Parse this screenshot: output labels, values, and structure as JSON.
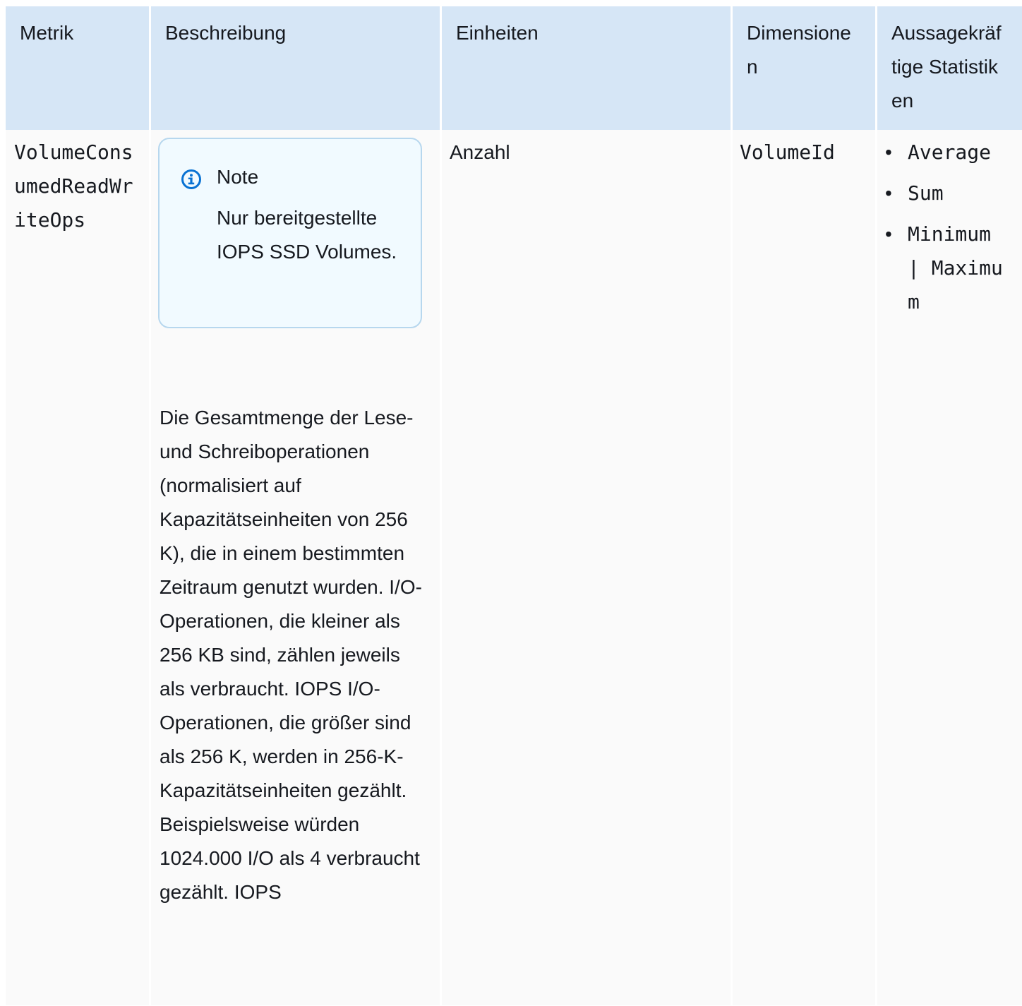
{
  "table": {
    "headers": {
      "metric": "Metrik",
      "description": "Beschreibung",
      "units": "Einheiten",
      "dimensions": "Dimensionen",
      "statistics": "Aussagekräftige Statistiken"
    },
    "row": {
      "metric": "VolumeConsumedReadWriteOps",
      "note": {
        "title": "Note",
        "text": "Nur bereitgestellte IOPS SSD Volumes."
      },
      "description": "Die Gesamtmenge der Lese- und Schreiboperationen (normalisiert auf Kapazitätseinheiten von 256 K), die in einem bestimmten Zeitraum genutzt wurden. I/O-Operationen, die kleiner als 256 KB sind, zählen jeweils als verbraucht. IOPS I/O-Operationen, die größer sind als 256 K, werden in 256-K-Kapazitätseinheiten gezählt. Beispielsweise würden 1024.000 I/O als 4 verbraucht gezählt. IOPS",
      "units": "Anzahl",
      "dimension": "VolumeId",
      "statistics": [
        "Average",
        "Sum",
        "Minimum | Maximum"
      ]
    }
  },
  "icons": {
    "note": "info-icon"
  },
  "colors": {
    "header_bg": "#d6e6f6",
    "cell_bg": "#fafafa",
    "note_bg": "#f1faff",
    "note_border": "#b7d7ee",
    "info_icon": "#0972d3"
  }
}
